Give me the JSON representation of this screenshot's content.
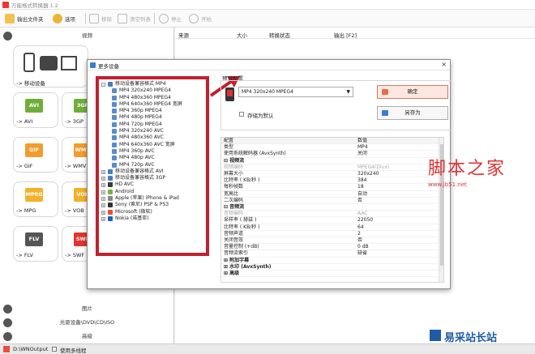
{
  "app": {
    "title": "万能格式转换器 1.2"
  },
  "toolbar": {
    "add_folder": "输出文件夹",
    "options": "选项",
    "remove": "移除",
    "clear_list": "清空列表",
    "stop": "停止",
    "start": "开始"
  },
  "left": {
    "section_video": "视频",
    "tiles": [
      {
        "label": "-> 移动设备"
      },
      {
        "label": "-> AVI",
        "badge": "AVI",
        "color": "#6fae3a"
      },
      {
        "label": "-> 3GP",
        "badge": "3GP",
        "color": "#6fae3a"
      },
      {
        "label": "-> GIF",
        "badge": "GIF",
        "color": "#f39c2b"
      },
      {
        "label": "-> WMV",
        "badge": "WMV",
        "color": "#f39c2b"
      },
      {
        "label": "-> MPG",
        "badge": "MPEG",
        "color": "#f3b12b"
      },
      {
        "label": "-> VOB",
        "badge": "VOB",
        "color": "#f3b12b"
      },
      {
        "label": "-> FLV",
        "badge": "FLV",
        "color": "#555555"
      },
      {
        "label": "-> SWF",
        "badge": "SWF",
        "color": "#e0352f"
      }
    ],
    "section_picture": "图片",
    "section_disc": "光驱设备\\DVD\\CD\\ISO",
    "section_advanced": "高级"
  },
  "list": {
    "headers": [
      "来源",
      "大小",
      "转换状态",
      "输出 [F2]"
    ]
  },
  "bottom": {
    "output_path": "D:\\WNOutput",
    "multithread": "使用多线程"
  },
  "dialog": {
    "title": "更多设备",
    "close": "×",
    "tree": [
      {
        "level": 0,
        "exp": "-",
        "text": "移动设备兼容格式 MP4",
        "icon": "#4a7dbf"
      },
      {
        "level": 1,
        "text": "MP4 320x240 MPEG4"
      },
      {
        "level": 1,
        "text": "MP4 480x360 MPEG4"
      },
      {
        "level": 1,
        "text": "MP4 640x360 MPEG4 宽屏"
      },
      {
        "level": 1,
        "text": "MP4 360p MPEG4"
      },
      {
        "level": 1,
        "text": "MP4 480p MPEG4"
      },
      {
        "level": 1,
        "text": "MP4 720p MPEG4"
      },
      {
        "level": 1,
        "text": "MP4 320x240 AVC"
      },
      {
        "level": 1,
        "text": "MP4 480x360 AVC"
      },
      {
        "level": 1,
        "text": "MP4 640x360 AVC 宽屏"
      },
      {
        "level": 1,
        "text": "MP4 360p AVC"
      },
      {
        "level": 1,
        "text": "MP4 480p AVC"
      },
      {
        "level": 1,
        "text": "MP4 720p AVC"
      },
      {
        "level": 0,
        "exp": "+",
        "text": "移动设备兼容格式 AVI",
        "icon": "#4a7dbf"
      },
      {
        "level": 0,
        "exp": "+",
        "text": "移动设备兼容格式 3GP",
        "icon": "#4a7dbf"
      },
      {
        "level": 0,
        "exp": "+",
        "text": "HD AVC",
        "icon": "#3b3b3b"
      },
      {
        "level": 0,
        "exp": "+",
        "text": "Android",
        "icon": "#7cb342"
      },
      {
        "level": 0,
        "exp": "+",
        "text": "Apple (苹果) iPhone & iPad",
        "icon": "#888888"
      },
      {
        "level": 0,
        "exp": "+",
        "text": "Sony (索尼) PSP & PS3",
        "icon": "#333333"
      },
      {
        "level": 0,
        "exp": "+",
        "text": "Microsoft (微软)",
        "icon": "#e8512b"
      },
      {
        "level": 0,
        "exp": "+",
        "text": "Nokia (诺基亚)",
        "icon": "#1565c0"
      }
    ],
    "preset_label": "预设配置",
    "preset_value": "MP4 320x240 MPEG4",
    "save_as_default": "存储为默认",
    "ok": "确定",
    "save_as": "另存为",
    "grid_header": {
      "key": "配置",
      "value": "数值"
    },
    "grid": [
      {
        "k": "类型",
        "v": "MP4"
      },
      {
        "k": "使用系统解码器 (AvxSynth)",
        "v": "关闭"
      },
      {
        "k": "⊟ 视频流",
        "v": "",
        "grp": true
      },
      {
        "k": "  视频编码",
        "v": "MPEG4(Divx)",
        "dim": true
      },
      {
        "k": "  屏幕大小",
        "v": "320x240"
      },
      {
        "k": "  比特率 ( KB/秒 )",
        "v": "384"
      },
      {
        "k": "  每秒帧数",
        "v": "18"
      },
      {
        "k": "  宽高比",
        "v": "自动"
      },
      {
        "k": "  二次编码",
        "v": "否"
      },
      {
        "k": "⊟ 音频流",
        "v": "",
        "grp": true
      },
      {
        "k": "  音频编码",
        "v": "AAC",
        "dim": true
      },
      {
        "k": "  采样率 ( 赫兹 )",
        "v": "22050"
      },
      {
        "k": "  比特率 ( KB/秒 )",
        "v": "64"
      },
      {
        "k": "  音频声道",
        "v": "2"
      },
      {
        "k": "  关闭音效",
        "v": "否"
      },
      {
        "k": "  音量控制 (+dB)",
        "v": "0 dB"
      },
      {
        "k": "  音频流索引",
        "v": "缺省"
      },
      {
        "k": "⊞ 附加字幕",
        "v": "",
        "grp": true
      },
      {
        "k": "⊞ 水印 (AvxSynth)",
        "v": "",
        "grp": true
      },
      {
        "k": "⊞ 高级",
        "v": "",
        "grp": true
      }
    ]
  },
  "watermark": {
    "site": "脚本之家",
    "url": "www.jb51.net",
    "brand": "易采站长站"
  }
}
